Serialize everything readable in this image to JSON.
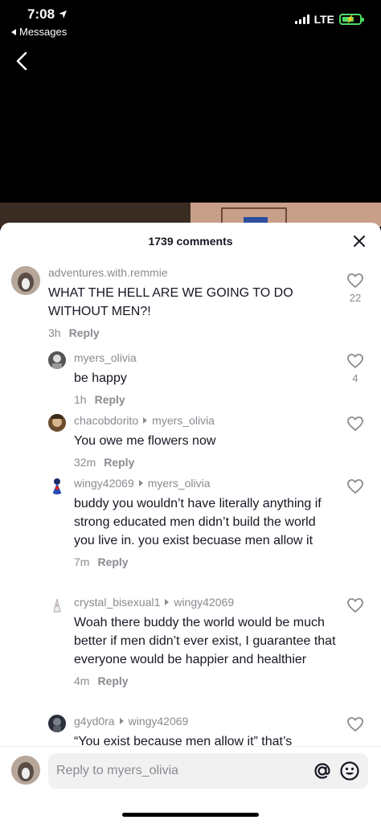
{
  "status_bar": {
    "time": "7:08",
    "back_app": "Messages",
    "network": "LTE"
  },
  "sheet": {
    "title": "1739 comments"
  },
  "comments": [
    {
      "username": "adventures.with.remmie",
      "reply_to": "",
      "text": "WHAT THE HELL ARE WE GOING TO DO WITHOUT MEN?!",
      "time": "3h",
      "reply_label": "Reply",
      "likes": "22"
    },
    {
      "username": "myers_olivia",
      "reply_to": "",
      "text": "be happy",
      "time": "1h",
      "reply_label": "Reply",
      "likes": "4"
    },
    {
      "username": "chacobdorito",
      "reply_to": "myers_olivia",
      "text": "You owe me flowers now",
      "time": "32m",
      "reply_label": "Reply",
      "likes": ""
    },
    {
      "username": "wingy42069",
      "reply_to": "myers_olivia",
      "text": "buddy you wouldn’t have literally anything if strong educated men didn’t build the world you live in. you exist becuase men allow it",
      "time": "7m",
      "reply_label": "Reply",
      "likes": ""
    },
    {
      "username": "crystal_bisexual1",
      "reply_to": "wingy42069",
      "text": "Woah there buddy the world would be much better if men didn’t ever exist, I guarantee that everyone would be happier and healthier",
      "time": "4m",
      "reply_label": "Reply",
      "likes": ""
    },
    {
      "username": "g4yd0ra",
      "reply_to": "wingy42069",
      "text": "“You exist because men allow it” that’s",
      "time": "",
      "reply_label": "",
      "likes": ""
    }
  ],
  "input": {
    "placeholder": "Reply to myers_olivia"
  },
  "colors": {
    "text_primary": "#161823",
    "text_secondary": "#8a8b91",
    "battery": "#4cd964"
  },
  "icons": [
    "location-arrow-icon",
    "signal-icon",
    "battery-icon",
    "back-chevron-icon",
    "close-icon",
    "heart-icon",
    "at-icon",
    "emoji-icon"
  ]
}
